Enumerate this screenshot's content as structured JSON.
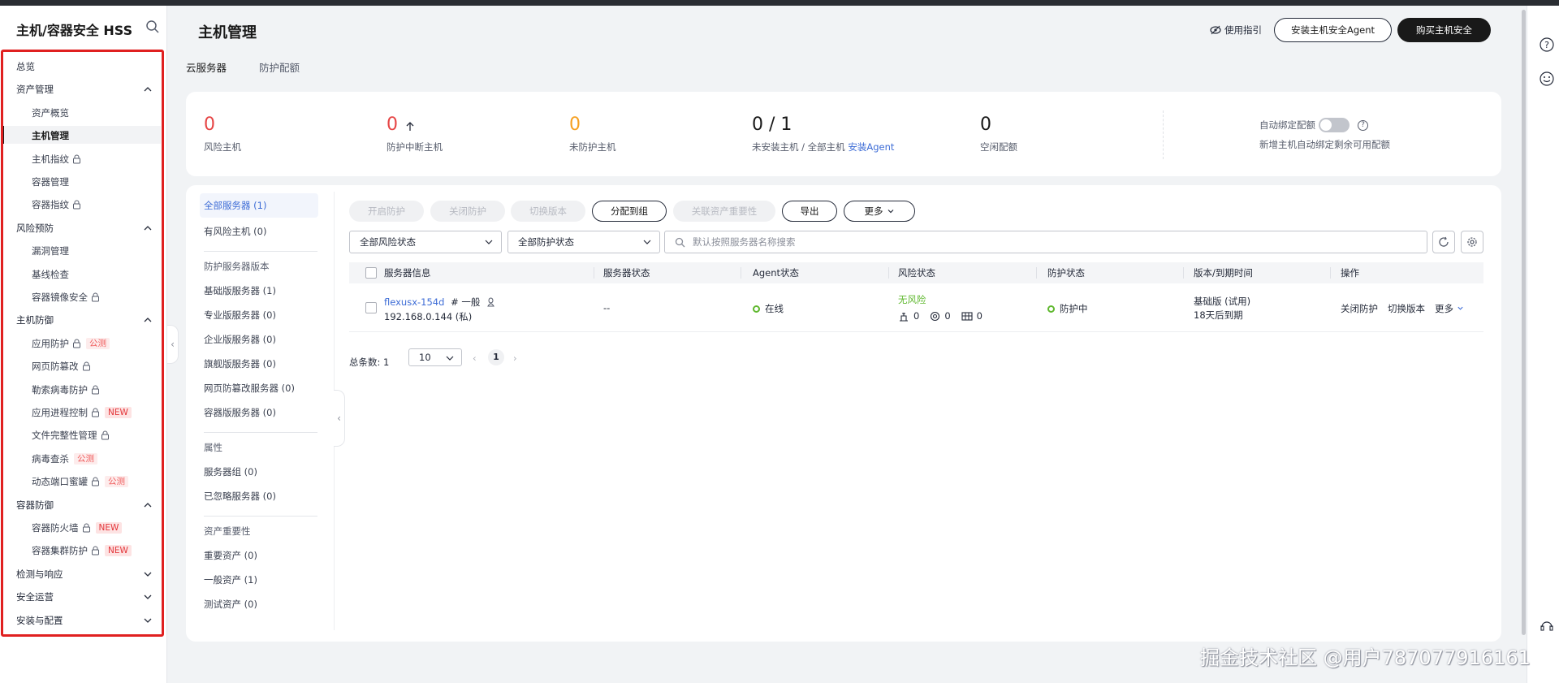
{
  "app": {
    "title": "主机/容器安全 HSS"
  },
  "sidebar": {
    "items": [
      {
        "label": "总览",
        "type": "group",
        "expanded": null
      },
      {
        "label": "资产管理",
        "type": "group",
        "expanded": true
      },
      {
        "label": "资产概览",
        "type": "sub"
      },
      {
        "label": "主机管理",
        "type": "sub",
        "active": true
      },
      {
        "label": "主机指纹",
        "type": "sub",
        "locked": true
      },
      {
        "label": "容器管理",
        "type": "sub"
      },
      {
        "label": "容器指纹",
        "type": "sub",
        "locked": true
      },
      {
        "label": "风险预防",
        "type": "group",
        "expanded": true
      },
      {
        "label": "漏洞管理",
        "type": "sub"
      },
      {
        "label": "基线检查",
        "type": "sub"
      },
      {
        "label": "容器镜像安全",
        "type": "sub",
        "locked": true
      },
      {
        "label": "主机防御",
        "type": "group",
        "expanded": true
      },
      {
        "label": "应用防护",
        "type": "sub",
        "locked": true,
        "badge": "公测"
      },
      {
        "label": "网页防篡改",
        "type": "sub",
        "locked": true
      },
      {
        "label": "勒索病毒防护",
        "type": "sub",
        "locked": true
      },
      {
        "label": "应用进程控制",
        "type": "sub",
        "locked": true,
        "badge": "NEW"
      },
      {
        "label": "文件完整性管理",
        "type": "sub",
        "locked": true
      },
      {
        "label": "病毒查杀",
        "type": "sub",
        "badge": "公测"
      },
      {
        "label": "动态端口蜜罐",
        "type": "sub",
        "locked": true,
        "badge": "公测"
      },
      {
        "label": "容器防御",
        "type": "group",
        "expanded": true
      },
      {
        "label": "容器防火墙",
        "type": "sub",
        "locked": true,
        "badge": "NEW"
      },
      {
        "label": "容器集群防护",
        "type": "sub",
        "locked": true,
        "badge": "NEW"
      },
      {
        "label": "检测与响应",
        "type": "group",
        "expanded": false
      },
      {
        "label": "安全运营",
        "type": "group",
        "expanded": false
      },
      {
        "label": "安装与配置",
        "type": "group",
        "expanded": false
      }
    ]
  },
  "header": {
    "title": "主机管理",
    "guide_label": "使用指引",
    "install_agent_label": "安装主机安全Agent",
    "buy_label": "购买主机安全"
  },
  "tabs": [
    {
      "label": "云服务器",
      "active": true
    },
    {
      "label": "防护配额",
      "active": false
    }
  ],
  "stats": {
    "risk_hosts": {
      "value": "0",
      "label": "风险主机"
    },
    "interrupted": {
      "value": "0",
      "label": "防护中断主机"
    },
    "unprotected": {
      "value": "0",
      "label": "未防护主机"
    },
    "uninstalled": {
      "value": "0 / 1",
      "label_a": "未安装主机",
      "label_b": "/ 全部主机",
      "link": "安装Agent"
    },
    "idle_quota": {
      "value": "0",
      "label": "空闲配额"
    },
    "auto_bind": {
      "label": "自动绑定配额",
      "desc": "新增主机自动绑定剩余可用配额",
      "on": false
    }
  },
  "filters": {
    "groups": [
      {
        "items": [
          "全部服务器 (1)",
          "有风险主机 (0)"
        ],
        "selected": 0
      },
      {
        "head": "防护服务器版本",
        "items": [
          "基础版服务器 (1)",
          "专业版服务器 (0)",
          "企业版服务器 (0)",
          "旗舰版服务器 (0)",
          "网页防篡改服务器 (0)",
          "容器版服务器 (0)"
        ]
      },
      {
        "head": "属性",
        "items": [
          "服务器组 (0)",
          "已忽略服务器 (0)"
        ]
      },
      {
        "head": "资产重要性",
        "items": [
          "重要资产 (0)",
          "一般资产 (1)",
          "测试资产 (0)"
        ]
      }
    ]
  },
  "toolbar": {
    "enable": "开启防护",
    "disable": "关闭防护",
    "switch": "切换版本",
    "assign_group": "分配到组",
    "importance": "关联资产重要性",
    "export": "导出",
    "more": "更多",
    "risk_select": "全部风险状态",
    "protect_select": "全部防护状态",
    "search_placeholder": "默认按照服务器名称搜索"
  },
  "table": {
    "columns": [
      "服务器信息",
      "服务器状态",
      "Agent状态",
      "风险状态",
      "防护状态",
      "版本/到期时间",
      "操作"
    ],
    "rows": [
      {
        "name": "flexusx-154d",
        "tag": "# 一般",
        "ip": "192.168.0.144 (私)",
        "server_status": "--",
        "agent_status": "在线",
        "risk": "无风险",
        "risk_counts": [
          "0",
          "0",
          "0"
        ],
        "protect_status": "防护中",
        "version": "基础版 (试用)",
        "expire": "18天后到期",
        "actions": [
          "关闭防护",
          "切换版本",
          "更多"
        ]
      }
    ]
  },
  "pagination": {
    "total_label": "总条数:",
    "total": "1",
    "page_size": "10",
    "current": "1"
  },
  "watermark": "掘金技术社区 @用户787077916161",
  "colors": {
    "risk_red": "#e64545",
    "unprotected_orange": "#f6a021",
    "link_blue": "#3d6cd6",
    "ok_green": "#5fb82e",
    "nav_highlight_border": "#e02020"
  }
}
